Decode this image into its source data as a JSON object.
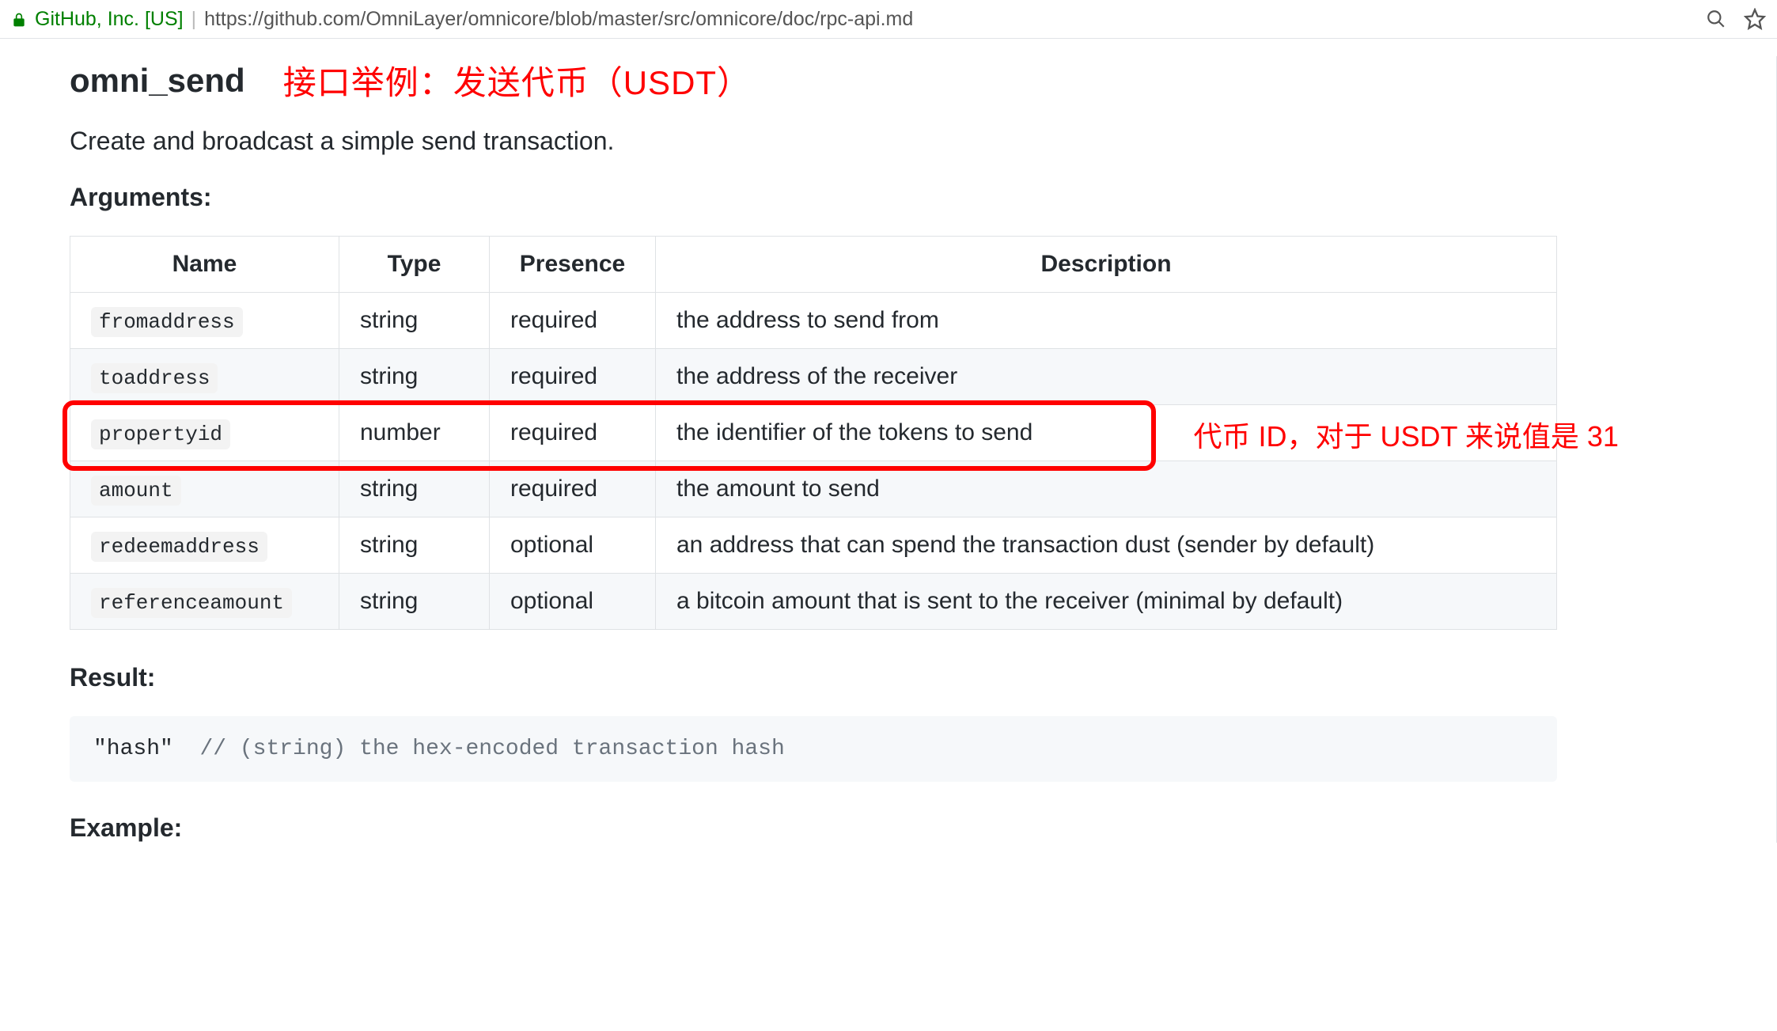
{
  "chrome": {
    "site_label": "GitHub, Inc. [US]",
    "url": "https://github.com/OmniLayer/omnicore/blob/master/src/omnicore/doc/rpc-api.md"
  },
  "doc": {
    "function_name": "omni_send",
    "title_annotation": "接口举例：发送代币（USDT）",
    "description": "Create and broadcast a simple send transaction.",
    "arguments_heading": "Arguments:",
    "result_heading": "Result:",
    "example_heading": "Example:",
    "result_code": {
      "literal": "\"hash\"",
      "comment": "// (string) the hex-encoded transaction hash"
    }
  },
  "args_table": {
    "headers": {
      "name": "Name",
      "type": "Type",
      "presence": "Presence",
      "description": "Description"
    },
    "rows": [
      {
        "name": "fromaddress",
        "type": "string",
        "presence": "required",
        "description": "the address to send from"
      },
      {
        "name": "toaddress",
        "type": "string",
        "presence": "required",
        "description": "the address of the receiver"
      },
      {
        "name": "propertyid",
        "type": "number",
        "presence": "required",
        "description": "the identifier of the tokens to send"
      },
      {
        "name": "amount",
        "type": "string",
        "presence": "required",
        "description": "the amount to send"
      },
      {
        "name": "redeemaddress",
        "type": "string",
        "presence": "optional",
        "description": "an address that can spend the transaction dust (sender by default)"
      },
      {
        "name": "referenceamount",
        "type": "string",
        "presence": "optional",
        "description": "a bitcoin amount that is sent to the receiver (minimal by default)"
      }
    ]
  },
  "annotation": {
    "highlighted_row_index": 2,
    "note": "代币 ID，对于 USDT 来说值是 31"
  }
}
